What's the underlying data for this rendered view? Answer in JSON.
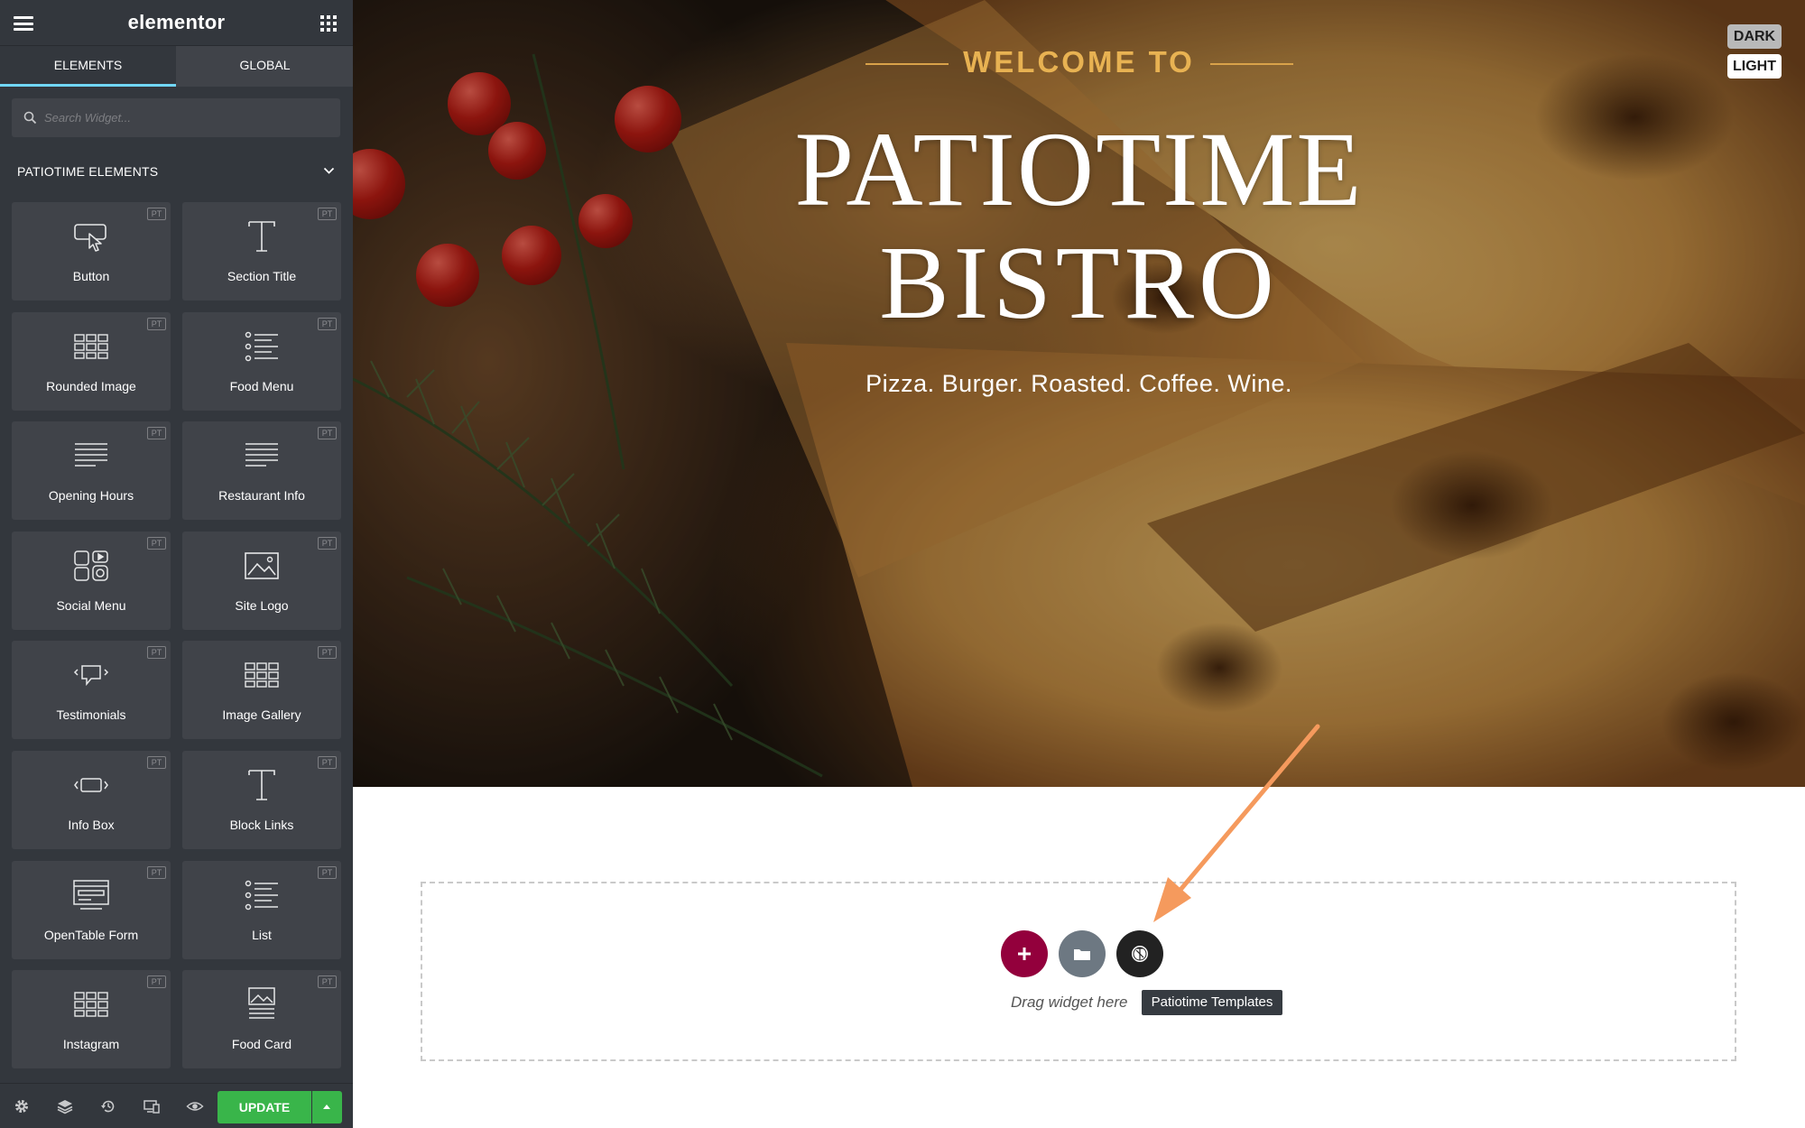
{
  "sidebar": {
    "logo": "elementor",
    "tabs": [
      {
        "label": "ELEMENTS",
        "active": true
      },
      {
        "label": "GLOBAL",
        "active": false
      }
    ],
    "search": {
      "placeholder": "Search Widget..."
    },
    "section_title": "PATIOTIME ELEMENTS",
    "badge": "PT",
    "widgets": [
      {
        "label": "Button",
        "icon": "cursor-click-icon"
      },
      {
        "label": "Section Title",
        "icon": "text-t-icon"
      },
      {
        "label": "Rounded Image",
        "icon": "image-grid-icon"
      },
      {
        "label": "Food Menu",
        "icon": "list-icon"
      },
      {
        "label": "Opening Hours",
        "icon": "text-lines-icon"
      },
      {
        "label": "Restaurant Info",
        "icon": "text-lines-icon"
      },
      {
        "label": "Social Menu",
        "icon": "social-icons-icon"
      },
      {
        "label": "Site Logo",
        "icon": "image-icon"
      },
      {
        "label": "Testimonials",
        "icon": "chat-bubble-icon"
      },
      {
        "label": "Image Gallery",
        "icon": "image-grid-icon"
      },
      {
        "label": "Info Box",
        "icon": "box-arrows-icon"
      },
      {
        "label": "Block Links",
        "icon": "text-t-icon"
      },
      {
        "label": "OpenTable Form",
        "icon": "form-icon"
      },
      {
        "label": "List",
        "icon": "list-icon"
      },
      {
        "label": "Instagram",
        "icon": "image-grid-icon"
      },
      {
        "label": "Food Card",
        "icon": "card-icon"
      }
    ],
    "footer": {
      "update_label": "UPDATE"
    }
  },
  "hero": {
    "welcome": "WELCOME TO",
    "title_line1": "PATIOTIME",
    "title_line2": "BISTRO",
    "tagline": "Pizza. Burger. Roasted. Coffee. Wine.",
    "mode_dark": "DARK",
    "mode_light": "LIGHT"
  },
  "dropzone": {
    "drag_text": "Drag widget here",
    "tooltip": "Patiotime Templates"
  },
  "colors": {
    "sidebar_bg": "#33373d",
    "widget_bg": "#404349",
    "tab_accent": "#71d7f7",
    "update_green": "#39b54a",
    "add_button": "#93003c",
    "welcome_gold": "#e8b252",
    "arrow_orange": "#f59a5d"
  }
}
